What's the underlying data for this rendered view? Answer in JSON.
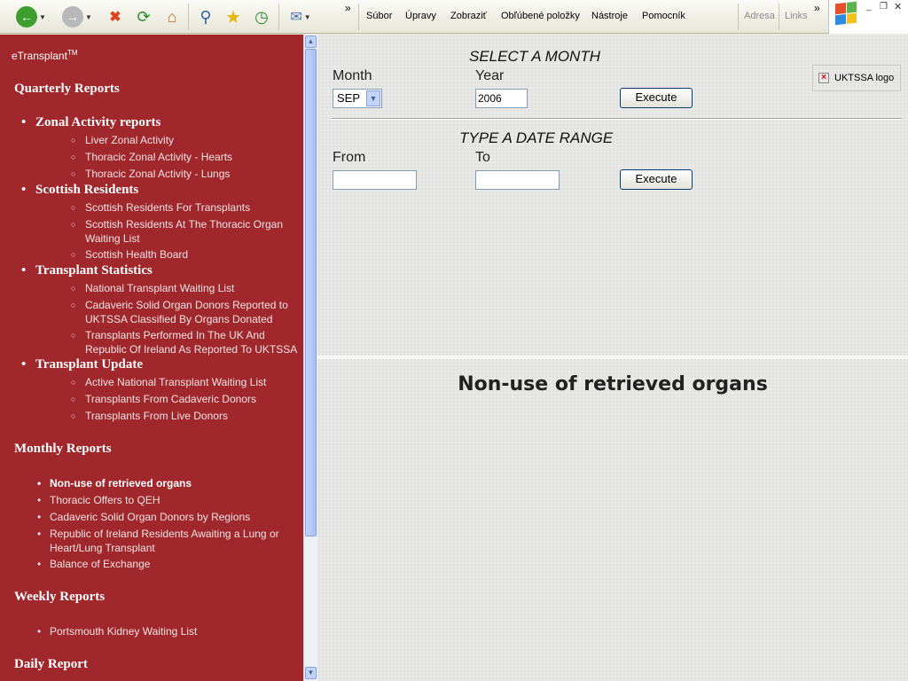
{
  "toolbar": {
    "menu": [
      "Súbor",
      "Úpravy",
      "Zobraziť",
      "Obľúbené položky",
      "Nástroje",
      "Pomocník"
    ],
    "address_label": "Adresa",
    "links_label": "Links",
    "overflow_chevron": "»"
  },
  "sidebar": {
    "brand": "eTransplant",
    "brand_sup": "TM",
    "quarterly": {
      "title": "Quarterly Reports",
      "groups": [
        {
          "title": "Zonal Activity reports",
          "items": [
            "Liver Zonal Activity",
            "Thoracic Zonal Activity - Hearts",
            "Thoracic Zonal Activity - Lungs"
          ]
        },
        {
          "title": "Scottish Residents",
          "items": [
            "Scottish Residents For Transplants",
            "Scottish Residents At The Thoracic Organ Waiting List",
            "Scottish Health Board"
          ]
        },
        {
          "title": "Transplant Statistics",
          "items": [
            "National Transplant Waiting List",
            "Cadaveric Solid Organ Donors Reported to UKTSSA Classified By Organs Donated",
            "Transplants Performed In The UK And Republic Of Ireland As Reported To UKTSSA"
          ]
        },
        {
          "title": "Transplant Update",
          "items": [
            "Active National Transplant Waiting List",
            "Transplants From Cadaveric Donors",
            "Transplants From Live Donors"
          ]
        }
      ]
    },
    "monthly": {
      "title": "Monthly Reports",
      "items": [
        "Non-use of retrieved organs",
        "Thoracic Offers to QEH",
        "Cadaveric Solid Organ Donors by Regions",
        "Republic of Ireland Residents Awaiting a Lung or Heart/Lung Transplant",
        "Balance of Exchange"
      ]
    },
    "weekly": {
      "title": "Weekly Reports",
      "items": [
        "Portsmouth Kidney Waiting List"
      ]
    },
    "daily": {
      "title": "Daily Report"
    }
  },
  "main": {
    "select_month_title": "SELECT A MONTH",
    "month_label": "Month",
    "month_value": "SEP",
    "year_label": "Year",
    "year_value": "2006",
    "execute_label": "Execute",
    "date_range_title": "TYPE A DATE RANGE",
    "from_label": "From",
    "to_label": "To",
    "from_value": "",
    "to_value": "",
    "logo_alt": "UKTSSA logo",
    "page_heading": "Non-use of retrieved organs"
  },
  "colors": {
    "sidebar_bg": "#a0272b",
    "main_bg": "#e8e8e6"
  }
}
